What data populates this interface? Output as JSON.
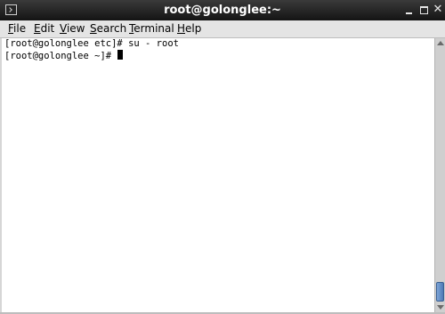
{
  "window": {
    "title": "root@golonglee:~",
    "close_glyph": "✕"
  },
  "menu": [
    {
      "mnemonic": "F",
      "rest": "ile"
    },
    {
      "mnemonic": "E",
      "rest": "dit"
    },
    {
      "mnemonic": "V",
      "rest": "iew"
    },
    {
      "mnemonic": "S",
      "rest": "earch"
    },
    {
      "mnemonic": "T",
      "rest": "erminal"
    },
    {
      "mnemonic": "H",
      "rest": "elp"
    }
  ],
  "terminal": {
    "lines": [
      "[root@golonglee etc]# su - root",
      "[root@golonglee ~]# "
    ]
  },
  "colors": {
    "titlebar": "#1e1e1e",
    "menubar": "#e4e4e4",
    "terminal_bg": "#ffffff",
    "scroll_thumb": "#5b86c0"
  },
  "icons": {
    "app": "terminal-app-icon",
    "minimize": "minimize-icon",
    "maximize": "maximize-icon",
    "close": "close-icon"
  }
}
